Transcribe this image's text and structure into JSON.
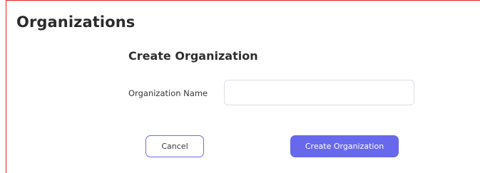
{
  "header": {
    "title": "Organizations"
  },
  "form": {
    "title": "Create Organization",
    "name_label": "Organization Name",
    "name_value": "",
    "name_placeholder": ""
  },
  "actions": {
    "cancel_label": "Cancel",
    "create_label": "Create Organization"
  },
  "colors": {
    "accent": "#6768ec",
    "frame_border": "#e02020"
  }
}
